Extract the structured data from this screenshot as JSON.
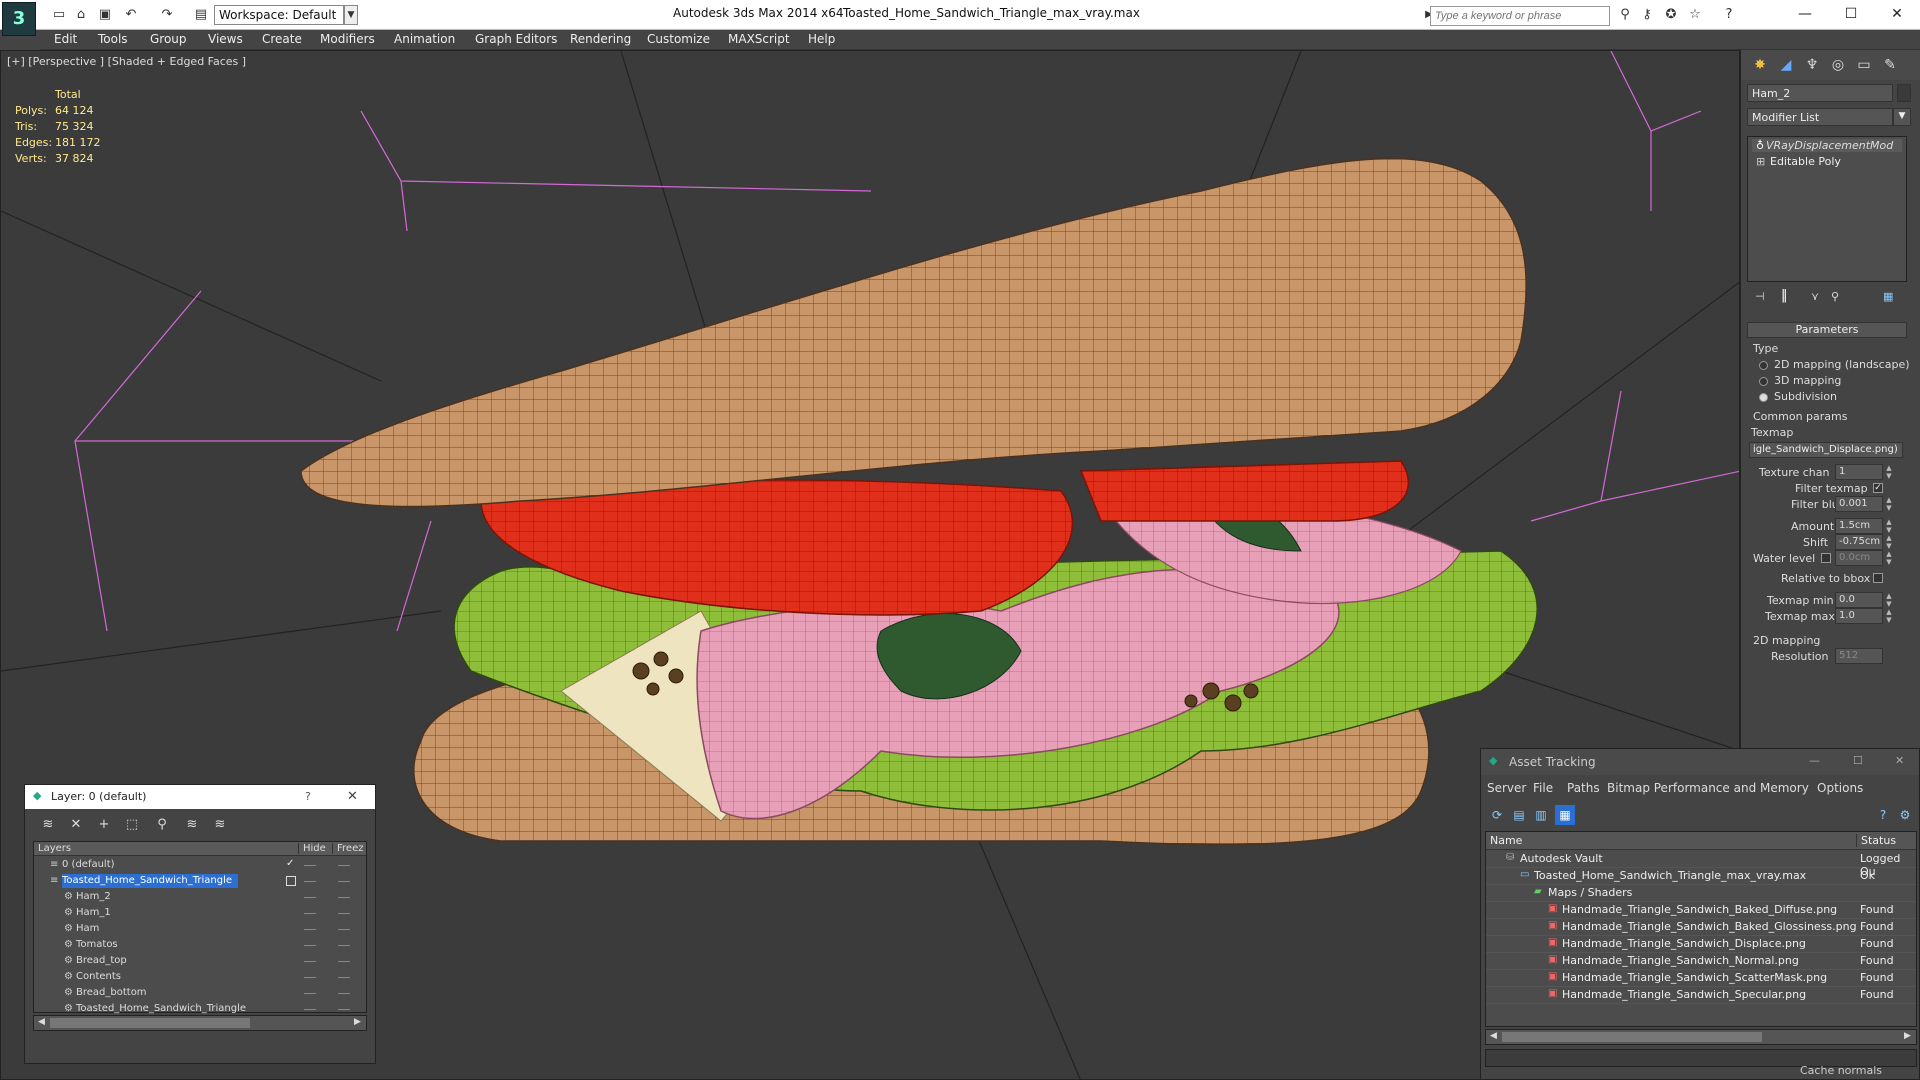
{
  "app": {
    "title": "Autodesk 3ds Max  2014 x64",
    "file": "Toasted_Home_Sandwich_Triangle_max_vray.max",
    "logo_text": "3",
    "workspace": "Workspace: Default",
    "search_placeholder": "Type a keyword or phrase"
  },
  "menu": [
    "Edit",
    "Tools",
    "Group",
    "Views",
    "Create",
    "Modifiers",
    "Animation",
    "Graph Editors",
    "Rendering",
    "Customize",
    "MAXScript",
    "Help"
  ],
  "viewport": {
    "label": "[+] [Perspective ] [Shaded + Edged Faces ]",
    "stats": {
      "header": "Total",
      "polys_label": "Polys:",
      "polys": "64 124",
      "tris_label": "Tris:",
      "tris": "75 324",
      "edges_label": "Edges:",
      "edges": "181 172",
      "verts_label": "Verts:",
      "verts": "37 824"
    }
  },
  "command_panel": {
    "object_name": "Ham_2",
    "modifier_list": "Modifier List",
    "stack": [
      "VRayDisplacementMod",
      "Editable Poly"
    ],
    "parameters_title": "Parameters",
    "type_label": "Type",
    "types": [
      "2D mapping (landscape)",
      "3D mapping",
      "Subdivision"
    ],
    "selected_type": 2,
    "common_params": "Common params",
    "texmap_label": "Texmap",
    "texmap_value": "igle_Sandwich_Displace.png)",
    "texture_chan_label": "Texture chan",
    "texture_chan": "1",
    "filter_texmap_label": "Filter texmap",
    "filter_blur_label": "Filter blur",
    "filter_blur": "0.001",
    "amount_label": "Amount",
    "amount": "1.5cm",
    "shift_label": "Shift",
    "shift": "-0.75cm",
    "water_level_label": "Water level",
    "water_level": "0.0cm",
    "relative_label": "Relative to bbox",
    "texmap_min_label": "Texmap min",
    "texmap_min": "0.0",
    "texmap_max_label": "Texmap max",
    "texmap_max": "1.0",
    "mapping_2d": "2D mapping",
    "resolution_label": "Resolution",
    "resolution": "512"
  },
  "layer_window": {
    "title": "Layer: 0 (default)",
    "help": "?",
    "columns": [
      "Layers",
      "Hide",
      "Freez"
    ],
    "rows": [
      {
        "name": "0 (default)",
        "indent": 0
      },
      {
        "name": "Toasted_Home_Sandwich_Triangle",
        "indent": 0
      },
      {
        "name": "Ham_2",
        "indent": 1
      },
      {
        "name": "Ham_1",
        "indent": 1
      },
      {
        "name": "Ham",
        "indent": 1
      },
      {
        "name": "Tomatos",
        "indent": 1
      },
      {
        "name": "Bread_top",
        "indent": 1
      },
      {
        "name": "Contents",
        "indent": 1
      },
      {
        "name": "Bread_bottom",
        "indent": 1
      },
      {
        "name": "Toasted_Home_Sandwich_Triangle",
        "indent": 1
      }
    ]
  },
  "asset_tracking": {
    "title": "Asset Tracking",
    "menu": [
      "Server",
      "File",
      "Paths",
      "Bitmap Performance and Memory",
      "Options"
    ],
    "columns": [
      "Name",
      "Status"
    ],
    "rows": [
      {
        "name": "Autodesk Vault",
        "status": "Logged Ou",
        "indent": 1
      },
      {
        "name": "Toasted_Home_Sandwich_Triangle_max_vray.max",
        "status": "Ok",
        "indent": 2
      },
      {
        "name": "Maps / Shaders",
        "status": "",
        "indent": 3
      },
      {
        "name": "Handmade_Triangle_Sandwich_Baked_Diffuse.png",
        "status": "Found",
        "indent": 4
      },
      {
        "name": "Handmade_Triangle_Sandwich_Baked_Glossiness.png",
        "status": "Found",
        "indent": 4
      },
      {
        "name": "Handmade_Triangle_Sandwich_Displace.png",
        "status": "Found",
        "indent": 4
      },
      {
        "name": "Handmade_Triangle_Sandwich_Normal.png",
        "status": "Found",
        "indent": 4
      },
      {
        "name": "Handmade_Triangle_Sandwich_ScatterMask.png",
        "status": "Found",
        "indent": 4
      },
      {
        "name": "Handmade_Triangle_Sandwich_Specular.png",
        "status": "Found",
        "indent": 4
      }
    ],
    "cache_normals": "Cache normals"
  },
  "colors": {
    "selection": "#2a6fd1",
    "stats_text": "#ffe98c",
    "viewport_bg": "#3b3b3b"
  }
}
